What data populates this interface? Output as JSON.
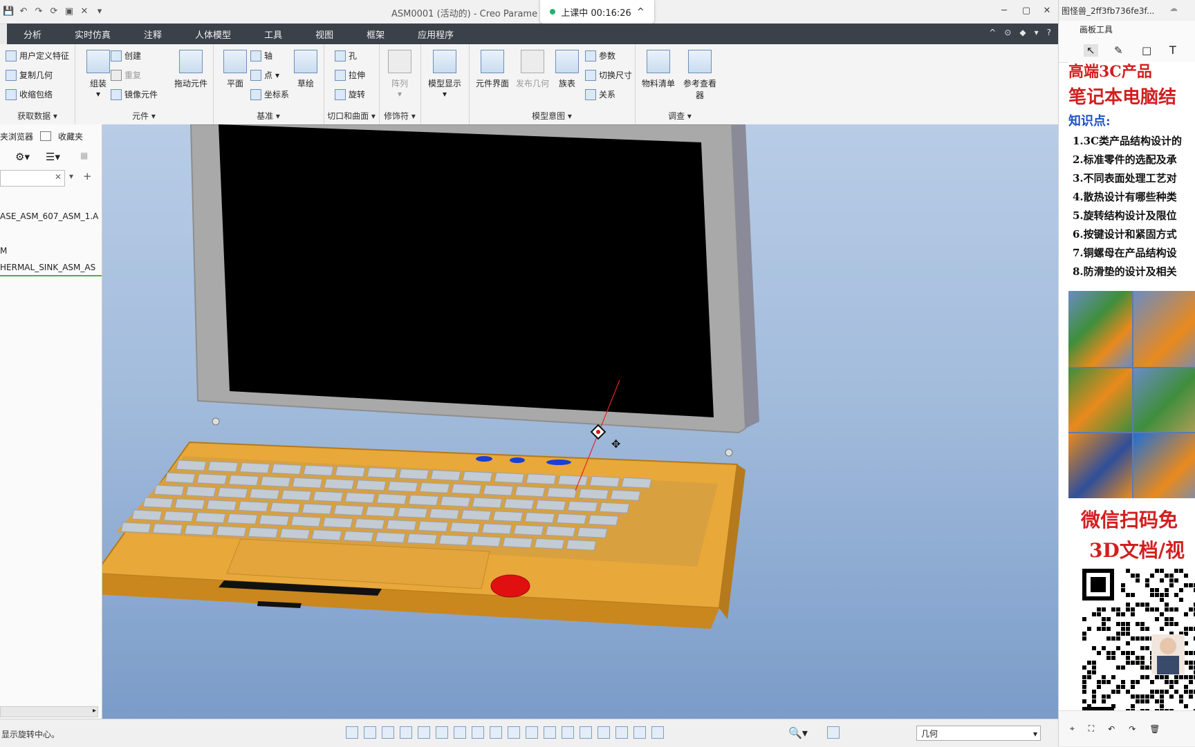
{
  "window": {
    "title": "ASM0001 (活动的) - Creo Parame",
    "recording": "上课中 00:16:26"
  },
  "menu": {
    "tabs": [
      "分析",
      "实时仿真",
      "注释",
      "人体模型",
      "工具",
      "视图",
      "框架",
      "应用程序"
    ]
  },
  "ribbon": {
    "get_data": {
      "label": "获取数据",
      "items": [
        "用户定义特征",
        "复制几何",
        "收缩包络"
      ]
    },
    "component": {
      "label": "元件",
      "assemble": "组装",
      "create": "创建",
      "repeat": "重复",
      "mirror": "镜像元件",
      "drag": "拖动元件"
    },
    "datum": {
      "label": "基准",
      "plane": "平面",
      "axis": "轴",
      "point": "点",
      "csys": "坐标系",
      "sketch": "草绘"
    },
    "cut_surface": {
      "label": "切口和曲面",
      "hole": "孔",
      "extrude": "拉伸",
      "revolve": "旋转"
    },
    "modifiers": {
      "label": "修饰符",
      "pattern": "阵列"
    },
    "model_display": {
      "label": "模型显示"
    },
    "model_intent": {
      "label": "模型意图",
      "comp_interface": "元件界面",
      "publish_geom": "发布几何",
      "family_table": "族表",
      "params": "参数",
      "switch_dims": "切换尺寸",
      "relations": "关系"
    },
    "investigate": {
      "label": "调查",
      "bom": "物料清单",
      "ref_viewer_1": "参考查看",
      "ref_viewer_2": "器"
    }
  },
  "left_panel": {
    "tabs": [
      "夹浏览器",
      "收藏夹"
    ],
    "tree": [
      "ASE_ASM_607_ASM_1.A",
      "M",
      "HERMAL_SINK_ASM_AS"
    ]
  },
  "status": {
    "message": "显示旋转中心。",
    "filter_value": "几何"
  },
  "overlay": {
    "user": "图怪兽_2ff3fb736fe3f...",
    "toolbox_title": "画板工具",
    "ad_heading": "笔记本电脑结",
    "ad_heading_top": "高端3C产品",
    "ad_points_label": "知识点:",
    "ad_points": [
      "1.3C类产品结构设计的",
      "2.标准零件的选配及承",
      "3.不同表面处理工艺对",
      "4.散热设计有哪些种类",
      "5.旋转结构设计及限位",
      "6.按键设计和紧固方式",
      "7.铜螺母在产品结构设",
      "8.防滑垫的设计及相关"
    ],
    "ad_cta_1": "微信扫码免",
    "ad_cta_2": "3D文档/视"
  },
  "colors": {
    "menu_bg": "#3b4149",
    "laptop_body": "#e8a83a",
    "laptop_lid": "#a9a9a9",
    "screen": "#000000",
    "keys": "#c3cbd4",
    "trackpoint": "#e01010",
    "ad_red": "#d21f1f"
  }
}
